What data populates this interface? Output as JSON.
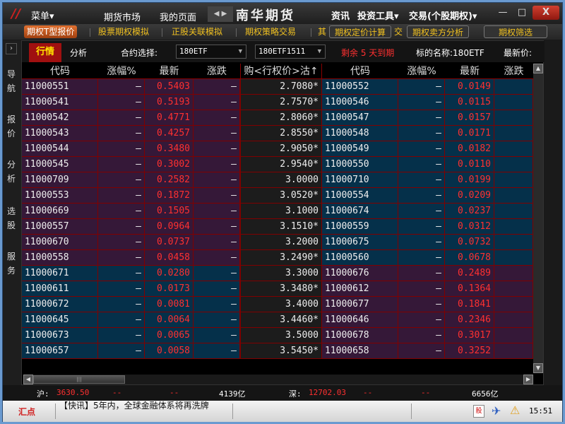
{
  "titlebar": {
    "menu": "菜单▾",
    "nav": [
      "期货市场",
      "我的页面"
    ],
    "brand": "南华期货",
    "right": [
      "资讯",
      "投资工具▾",
      "交易(个股期权)▾"
    ],
    "minimize": "—",
    "maximize": "□",
    "close": "X"
  },
  "toolbar": {
    "items": [
      "期权T型报价",
      "股票期权模拟",
      "正股关联模拟",
      "期权策略交易",
      "其",
      "期权定价计算",
      "交",
      "期权卖方分析",
      "期权筛选"
    ]
  },
  "leftnav": {
    "expand": "›",
    "groups": [
      "导航",
      "报价",
      "分析",
      "选股",
      "服务"
    ]
  },
  "tabs": {
    "active": "行情",
    "other": "分析",
    "contract_label": "合约选择:",
    "contract_value": "180ETF",
    "month_value": "180ETF1511",
    "expiry": "剩余 5 天到期",
    "underlying": "标的名称:180ETF",
    "latest": "最新价:"
  },
  "headers": [
    "代码",
    "涨幅%",
    "最新",
    "涨跌",
    "购<行权价>沽↑",
    "代码",
    "涨幅%",
    "最新",
    "涨跌"
  ],
  "colors": {
    "purple": "#351838",
    "teal": "#05304a",
    "strike": "#1c1c1c",
    "grid": "#800000",
    "price": "#ff3030"
  },
  "rows": [
    [
      "11000551",
      "—",
      "0.5403",
      "—",
      "2.7080*",
      "11000552",
      "—",
      "0.0149"
    ],
    [
      "11000541",
      "—",
      "0.5193",
      "—",
      "2.7570*",
      "11000546",
      "—",
      "0.0115"
    ],
    [
      "11000542",
      "—",
      "0.4771",
      "—",
      "2.8060*",
      "11000547",
      "—",
      "0.0157"
    ],
    [
      "11000543",
      "—",
      "0.4257",
      "—",
      "2.8550*",
      "11000548",
      "—",
      "0.0171"
    ],
    [
      "11000544",
      "—",
      "0.3480",
      "—",
      "2.9050*",
      "11000549",
      "—",
      "0.0182"
    ],
    [
      "11000545",
      "—",
      "0.3002",
      "—",
      "2.9540*",
      "11000550",
      "—",
      "0.0110"
    ],
    [
      "11000709",
      "—",
      "0.2582",
      "—",
      "3.0000",
      "11000710",
      "—",
      "0.0199"
    ],
    [
      "11000553",
      "—",
      "0.1872",
      "—",
      "3.0520*",
      "11000554",
      "—",
      "0.0209"
    ],
    [
      "11000669",
      "—",
      "0.1505",
      "—",
      "3.1000",
      "11000674",
      "—",
      "0.0237"
    ],
    [
      "11000557",
      "—",
      "0.0964",
      "—",
      "3.1510*",
      "11000559",
      "—",
      "0.0312"
    ],
    [
      "11000670",
      "—",
      "0.0737",
      "—",
      "3.2000",
      "11000675",
      "—",
      "0.0732"
    ],
    [
      "11000558",
      "—",
      "0.0458",
      "—",
      "3.2490*",
      "11000560",
      "—",
      "0.0678"
    ],
    [
      "11000671",
      "—",
      "0.0280",
      "—",
      "3.3000",
      "11000676",
      "—",
      "0.2489"
    ],
    [
      "11000611",
      "—",
      "0.0173",
      "—",
      "3.3480*",
      "11000612",
      "—",
      "0.1364"
    ],
    [
      "11000672",
      "—",
      "0.0081",
      "—",
      "3.4000",
      "11000677",
      "—",
      "0.1841"
    ],
    [
      "11000645",
      "—",
      "0.0064",
      "—",
      "3.4460*",
      "11000646",
      "—",
      "0.2346"
    ],
    [
      "11000673",
      "—",
      "0.0065",
      "—",
      "3.5000",
      "11000678",
      "—",
      "0.3017"
    ],
    [
      "11000657",
      "—",
      "0.0058",
      "—",
      "3.5450*",
      "11000658",
      "—",
      "0.3252"
    ]
  ],
  "in_the_money_rows": 12,
  "status": {
    "sh_label": "沪:",
    "sh_value": "3630.50",
    "sh_d1": "--",
    "sh_d2": "--",
    "sh_amount": "4139亿",
    "sz_label": "深:",
    "sz_value": "12702.03",
    "sz_d1": "--",
    "sz_d2": "--",
    "sz_amount": "6656亿"
  },
  "bottom": {
    "logo": "汇点",
    "news": "【快讯】5年内，全球金融体系将再洗牌",
    "time": "15:51"
  }
}
